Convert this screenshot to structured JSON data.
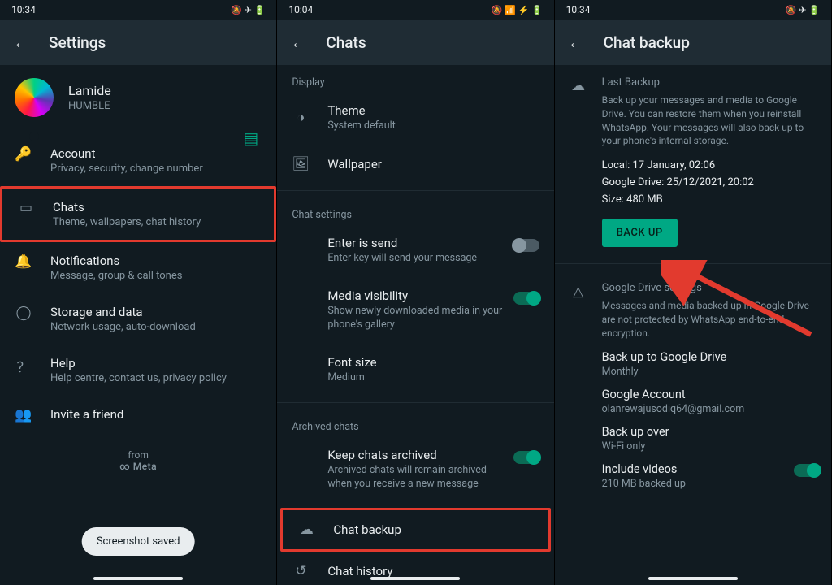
{
  "p1": {
    "time": "10:34",
    "status_icons": "🔕 ✈ 🔋",
    "title": "Settings",
    "profile": {
      "name": "Lamide",
      "status": "HUMBLE"
    },
    "rows": [
      {
        "icon": "🔑",
        "title": "Account",
        "sub": "Privacy, security, change number"
      },
      {
        "icon": "▭",
        "title": "Chats",
        "sub": "Theme, wallpapers, chat history"
      },
      {
        "icon": "🔔",
        "title": "Notifications",
        "sub": "Message, group & call tones"
      },
      {
        "icon": "◯",
        "title": "Storage and data",
        "sub": "Network usage, auto-download"
      },
      {
        "icon": "？",
        "title": "Help",
        "sub": "Help centre, contact us, privacy policy"
      },
      {
        "icon": "👥",
        "title": "Invite a friend",
        "sub": ""
      }
    ],
    "from": "from",
    "meta": "∞ Meta",
    "toast": "Screenshot saved"
  },
  "p2": {
    "time": "10:04",
    "status_icons": "🔕 📶 ⚡ 🔋",
    "title": "Chats",
    "sections": {
      "display": "Display",
      "chatsettings": "Chat settings",
      "archived": "Archived chats"
    },
    "theme": {
      "title": "Theme",
      "sub": "System default"
    },
    "wallpaper": {
      "title": "Wallpaper"
    },
    "enter": {
      "title": "Enter is send",
      "sub": "Enter key will send your message"
    },
    "media": {
      "title": "Media visibility",
      "sub": "Show newly downloaded media in your phone's gallery"
    },
    "fontsize": {
      "title": "Font size",
      "sub": "Medium"
    },
    "keep": {
      "title": "Keep chats archived",
      "sub": "Archived chats will remain archived when you receive a new message"
    },
    "backup": {
      "title": "Chat backup"
    },
    "history": {
      "title": "Chat history"
    }
  },
  "p3": {
    "time": "10:34",
    "status_icons": "🔕 ✈ 🔋",
    "title": "Chat backup",
    "lastbackup": {
      "heading": "Last Backup",
      "desc": "Back up your messages and media to Google Drive. You can restore them when you reinstall WhatsApp. Your messages will also back up to your phone's internal storage.",
      "local": "Local: 17 January, 02:06",
      "drive": "Google Drive: 25/12/2021, 20:02",
      "size": "Size: 480 MB",
      "button": "BACK UP"
    },
    "gdrive": {
      "heading": "Google Drive settings",
      "desc": "Messages and media backed up in Google Drive are not protected by WhatsApp end-to-end encryption.",
      "rows": [
        {
          "title": "Back up to Google Drive",
          "sub": "Monthly"
        },
        {
          "title": "Google Account",
          "sub": "olanrewajusodiq64@gmail.com"
        },
        {
          "title": "Back up over",
          "sub": "Wi-Fi only"
        },
        {
          "title": "Include videos",
          "sub": "210 MB backed up"
        }
      ]
    }
  }
}
